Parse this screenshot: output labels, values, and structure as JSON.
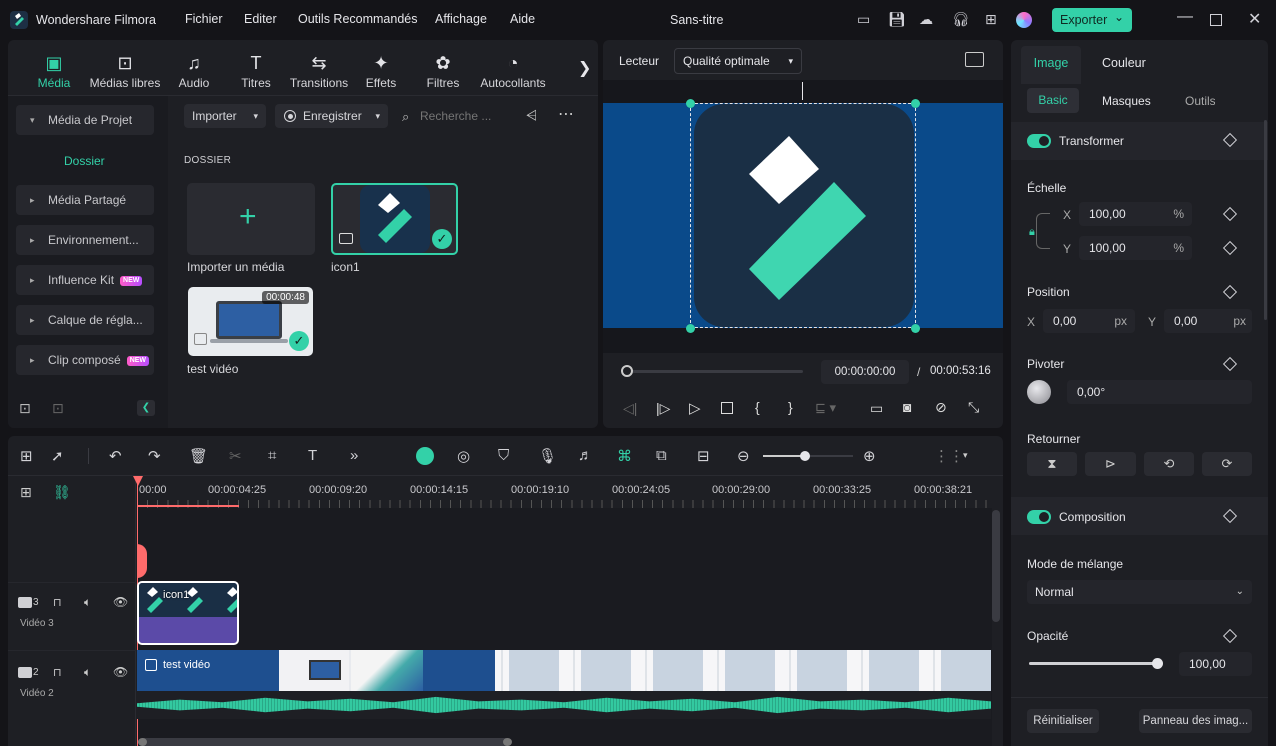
{
  "app": {
    "name": "Wondershare Filmora",
    "doc_title": "Sans-titre",
    "export_label": "Exporter",
    "export_chevron": "⌄"
  },
  "menu": [
    "Fichier",
    "Editer",
    "Outils Recommandés",
    "Affichage",
    "Aide"
  ],
  "media_tabs": [
    {
      "label": "Média",
      "icon": "▣"
    },
    {
      "label": "Médias libres",
      "icon": "⊡"
    },
    {
      "label": "Audio",
      "icon": "♫"
    },
    {
      "label": "Titres",
      "icon": "T"
    },
    {
      "label": "Transitions",
      "icon": "⇆"
    },
    {
      "label": "Effets",
      "icon": "✦"
    },
    {
      "label": "Filtres",
      "icon": "✿"
    },
    {
      "label": "Autocollants",
      "icon": "◔"
    }
  ],
  "sidebar": {
    "items": [
      {
        "label": "Média de Projet"
      },
      {
        "label": "Dossier"
      },
      {
        "label": "Média Partagé"
      },
      {
        "label": "Environnement..."
      },
      {
        "label": "Influence Kit",
        "badge": "NEW"
      },
      {
        "label": "Calque de régla..."
      },
      {
        "label": "Clip composé",
        "badge": "NEW"
      }
    ]
  },
  "media_toolbar": {
    "import_label": "Importer",
    "record_label": "Enregistrer",
    "search_placeholder": "Recherche ..."
  },
  "media_area": {
    "folder_heading": "DOSSIER",
    "items": [
      {
        "label": "Importer un média"
      },
      {
        "label": "icon1"
      },
      {
        "label": "test vidéo",
        "duration": "00:00:48"
      }
    ]
  },
  "player": {
    "label": "Lecteur",
    "quality": "Qualité optimale",
    "current_time": "00:00:00:00",
    "separator": "/",
    "total_time": "00:00:53:16",
    "progress": 0
  },
  "right_panel": {
    "tabs": [
      "Image",
      "Couleur"
    ],
    "subtabs": [
      "Basic",
      "Masques",
      "Outils"
    ],
    "transform": {
      "title": "Transformer",
      "scale_label": "Échelle",
      "scale_x_axis": "X",
      "scale_x": "100,00",
      "scale_y_axis": "Y",
      "scale_y": "100,00",
      "unit_percent": "%",
      "position_label": "Position",
      "pos_x_axis": "X",
      "pos_x": "0,00",
      "pos_y_axis": "Y",
      "pos_y": "0,00",
      "unit_px": "px",
      "rotate_label": "Pivoter",
      "rotate": "0,00°",
      "flip_label": "Retourner"
    },
    "composition": {
      "title": "Composition",
      "blend_label": "Mode de mélange",
      "blend_value": "Normal",
      "opacity_label": "Opacité",
      "opacity": "100,00",
      "opacity_level": 1.0
    },
    "footer": {
      "reset": "Réinitialiser",
      "keyframe_panel": "Panneau des imag..."
    }
  },
  "timeline": {
    "ruler": [
      "00:00",
      "00:00:04:25",
      "00:00:09:20",
      "00:00:14:15",
      "00:00:19:10",
      "00:00:24:05",
      "00:00:29:00",
      "00:00:33:25",
      "00:00:38:21"
    ],
    "tracks": [
      {
        "num": "3",
        "name": "Vidéo 3",
        "clip": "icon1"
      },
      {
        "num": "2",
        "name": "Vidéo 2",
        "clip": "test vidéo"
      }
    ]
  },
  "colors": {
    "accent": "#33d1a8",
    "preview_bg": "#0a4a8a",
    "clip_purple": "#5b4aa8"
  }
}
